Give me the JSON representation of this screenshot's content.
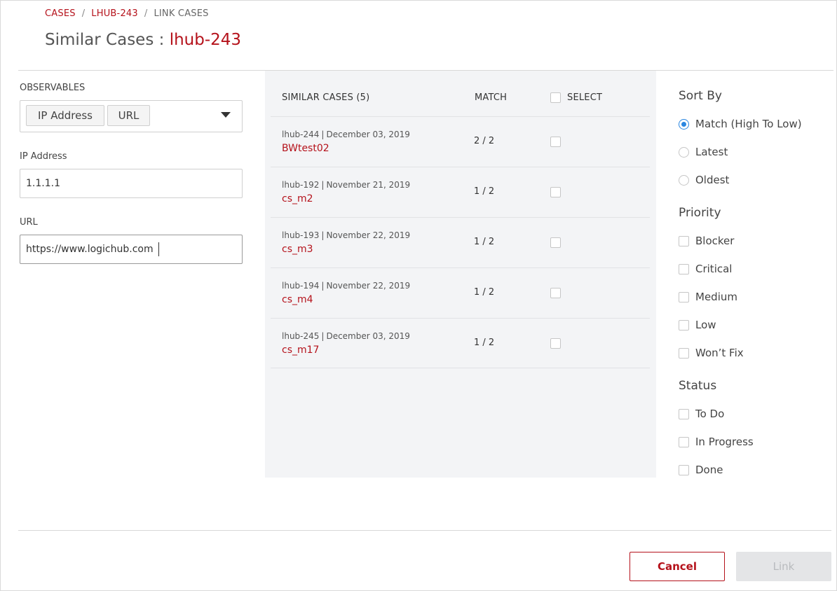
{
  "breadcrumb": {
    "cases": "CASES",
    "case": "LHUB-243",
    "current": "LINK CASES",
    "separator": "/"
  },
  "title": {
    "prefix": "Similar Cases :",
    "case_id": "lhub-243"
  },
  "observables": {
    "label": "OBSERVABLES",
    "chips": [
      "IP Address",
      "URL"
    ]
  },
  "fields": {
    "ip_label": "IP Address",
    "ip_value": "1.1.1.1",
    "url_label": "URL",
    "url_value": "https://www.logichub.com"
  },
  "table": {
    "header_cases": "SIMILAR CASES (5)",
    "header_match": "MATCH",
    "header_select": "SELECT",
    "rows": [
      {
        "id": "lhub-244",
        "date": "December 03, 2019",
        "name": "BWtest02",
        "match": "2 / 2"
      },
      {
        "id": "lhub-192",
        "date": "November 21, 2019",
        "name": "cs_m2",
        "match": "1 / 2"
      },
      {
        "id": "lhub-193",
        "date": "November 22, 2019",
        "name": "cs_m3",
        "match": "1 / 2"
      },
      {
        "id": "lhub-194",
        "date": "November 22, 2019",
        "name": "cs_m4",
        "match": "1 / 2"
      },
      {
        "id": "lhub-245",
        "date": "December 03, 2019",
        "name": "cs_m17",
        "match": "1 / 2"
      }
    ]
  },
  "sort": {
    "title": "Sort By",
    "options": [
      "Match (High To Low)",
      "Latest",
      "Oldest"
    ],
    "selected": "Match (High To Low)"
  },
  "priority": {
    "title": "Priority",
    "options": [
      "Blocker",
      "Critical",
      "Medium",
      "Low",
      "Won’t Fix"
    ]
  },
  "status": {
    "title": "Status",
    "options": [
      "To Do",
      "In Progress",
      "Done"
    ]
  },
  "buttons": {
    "cancel": "Cancel",
    "link": "Link"
  },
  "colors": {
    "accent": "#b5121b",
    "radio_selected": "#2a86e0",
    "panel_bg": "#f3f4f6"
  }
}
